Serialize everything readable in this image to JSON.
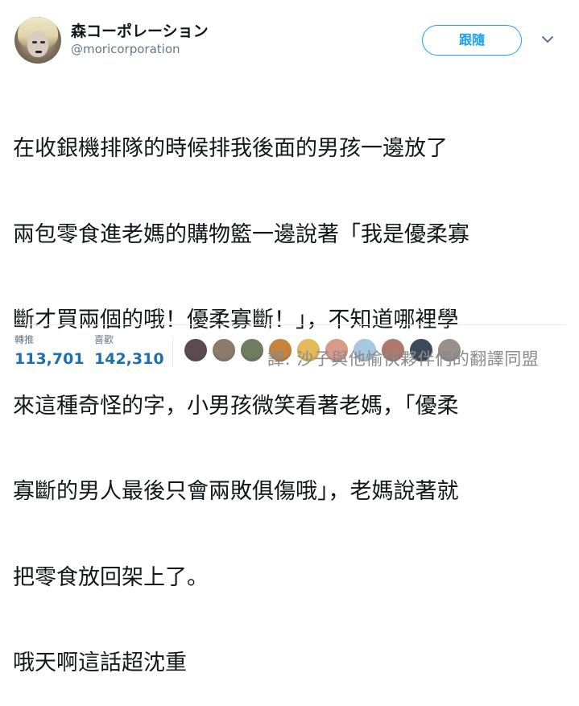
{
  "user": {
    "display_name": "森コーポレーション",
    "handle": "@moricorporation"
  },
  "actions": {
    "follow_label": "跟隨",
    "more_icon": "chevron-down-icon"
  },
  "tweet": {
    "lines": [
      "在收銀機排隊的時候排我後面的男孩一邊放了",
      "兩包零食進老媽的購物籃一邊說著「我是優柔寡",
      "斷才買兩個的哦！優柔寡斷！」，不知道哪裡學",
      "來這種奇怪的字，小男孩微笑看著老媽，「優柔",
      "寡斷的男人最後只會兩敗俱傷哦」，老媽說著就",
      "把零食放回架上了。",
      "哦天啊這話超沈重"
    ]
  },
  "stats": {
    "retweets_label": "轉推",
    "retweets_count": "113,701",
    "likes_label": "喜歡",
    "likes_count": "142,310"
  },
  "liker_avatars": [
    {
      "name": "liker-avatar-1",
      "color": "#5b4a4f"
    },
    {
      "name": "liker-avatar-2",
      "color": "#8c7b6a"
    },
    {
      "name": "liker-avatar-3",
      "color": "#6f7d5e"
    },
    {
      "name": "liker-avatar-4",
      "color": "#c7823b"
    },
    {
      "name": "liker-avatar-5",
      "color": "#e4b95a"
    },
    {
      "name": "liker-avatar-6",
      "color": "#d99a8a"
    },
    {
      "name": "liker-avatar-7",
      "color": "#a7c9e0"
    },
    {
      "name": "liker-avatar-8",
      "color": "#b0776b"
    },
    {
      "name": "liker-avatar-9",
      "color": "#3c4a5a"
    },
    {
      "name": "liker-avatar-10",
      "color": "#9a8f8a"
    }
  ],
  "watermark": "譯: 沙子與他愉快夥伴們的翻譯同盟",
  "colors": {
    "accent": "#1da1f2",
    "count": "#1b6fb3",
    "secondary_text": "#657786"
  }
}
